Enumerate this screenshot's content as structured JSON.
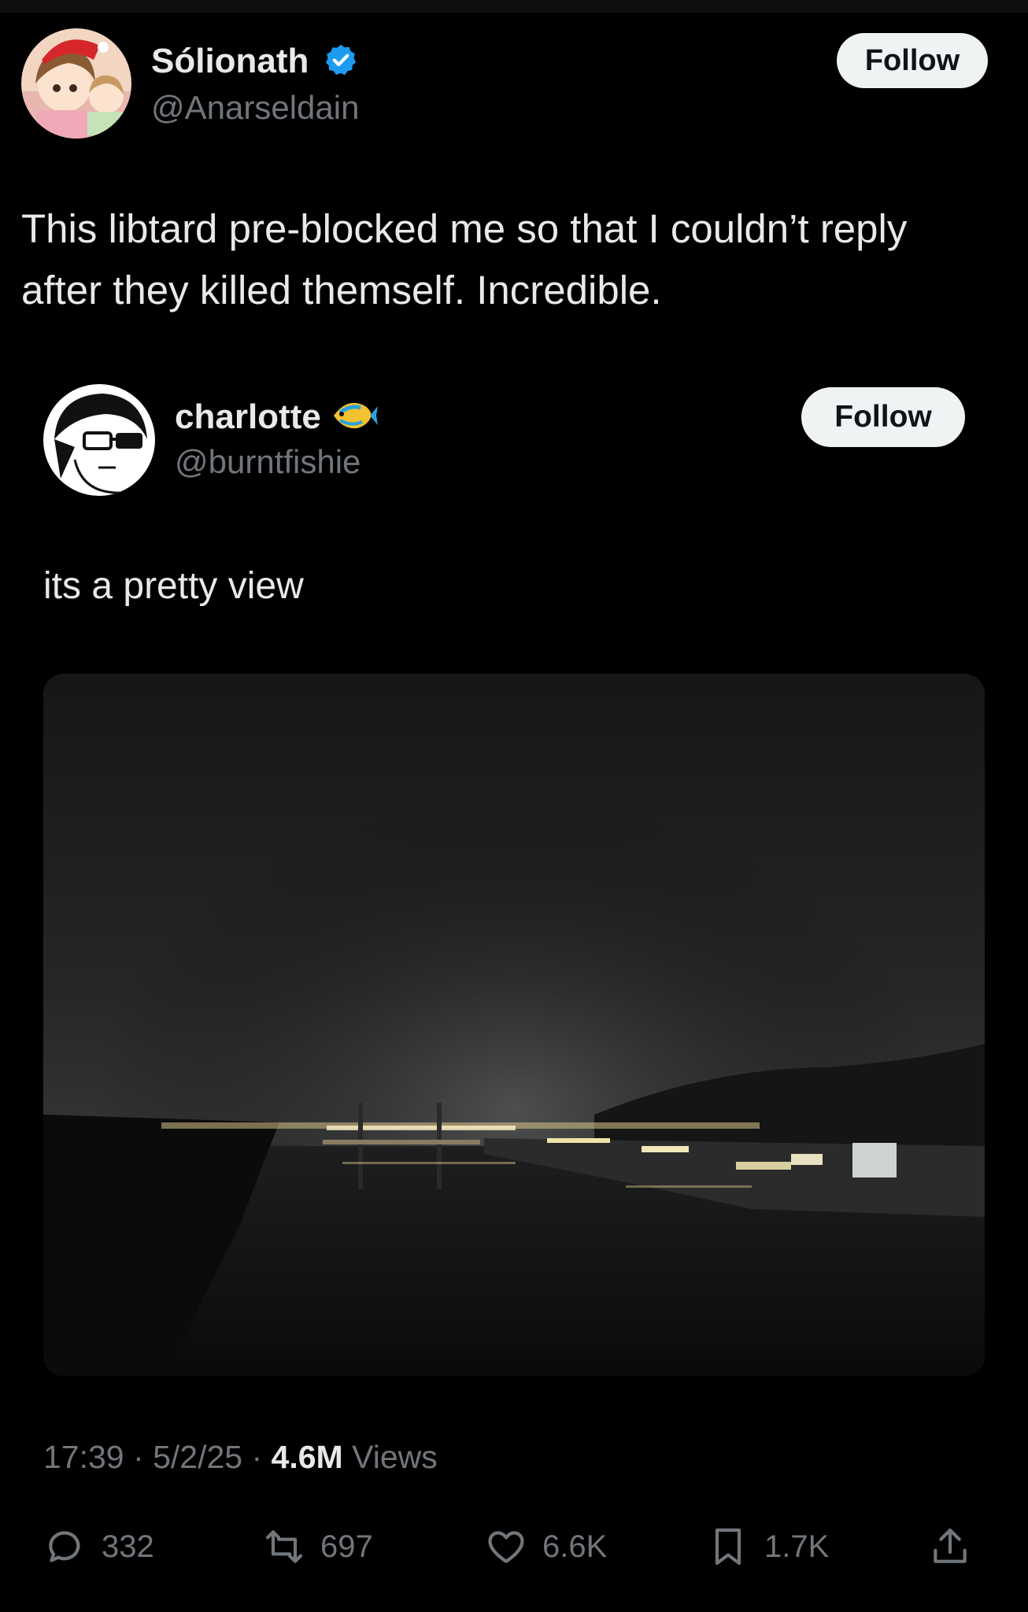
{
  "main_post": {
    "author": {
      "display_name": "Sólionath",
      "handle": "@Anarseldain",
      "verified_icon": "verified-badge-icon",
      "verified_color": "#1d9bf0"
    },
    "follow_label": "Follow",
    "text_line1": "This libtard pre-blocked me so that I couldn’t reply",
    "text_line2": "after they killed themself. Incredible."
  },
  "quoted_post": {
    "author": {
      "display_name": "charlotte",
      "handle": "@burntfishie",
      "emoji_icon": "tropical-fish-icon"
    },
    "follow_label": "Follow",
    "text": "its a pretty view",
    "media": {
      "subject": "night-river-cityscape-photo"
    },
    "meta": {
      "time": "17:39",
      "date": "5/2/25",
      "separator": "·",
      "views_count": "4.6M",
      "views_label": "Views"
    }
  },
  "actions": {
    "replies": {
      "icon": "reply-icon",
      "count": "332"
    },
    "reposts": {
      "icon": "repost-icon",
      "count": "697"
    },
    "likes": {
      "icon": "heart-icon",
      "count": "6.6K"
    },
    "bookmarks": {
      "icon": "bookmark-icon",
      "count": "1.7K"
    },
    "share": {
      "icon": "share-icon"
    }
  },
  "colors": {
    "background": "#000000",
    "text_primary": "#e7e9ea",
    "text_secondary": "#71767b",
    "button_bg": "#eff3f4",
    "button_text": "#0f1419"
  }
}
